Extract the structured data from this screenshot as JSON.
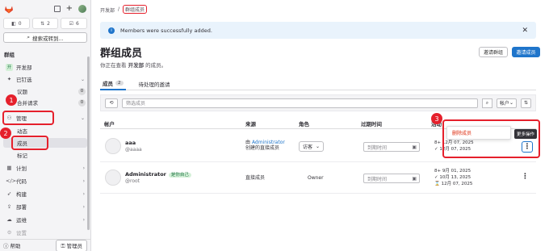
{
  "sidebar": {
    "counters": [
      {
        "icon": "issues-icon",
        "value": "0"
      },
      {
        "icon": "merge-request-icon",
        "value": "2"
      },
      {
        "icon": "todo-icon",
        "value": "6"
      }
    ],
    "search_label": "搜索或转到...",
    "group_label": "群组",
    "items": [
      {
        "label": "开发部",
        "icon": "开"
      },
      {
        "label": "已钉选",
        "icon": "pin-icon"
      },
      {
        "label": "议题",
        "badge": "0"
      },
      {
        "label": "合并请求",
        "badge": "0"
      },
      {
        "label": "管理",
        "icon": "manage-icon"
      },
      {
        "label": "动态"
      },
      {
        "label": "成员"
      },
      {
        "label": "标记"
      },
      {
        "label": "计划"
      },
      {
        "label": "代码"
      },
      {
        "label": "构建"
      },
      {
        "label": "部署"
      },
      {
        "label": "运维"
      },
      {
        "label": "设置"
      }
    ],
    "help_label": "帮助",
    "admin_label": "管理员"
  },
  "breadcrumb": [
    "开发部",
    "群组成员"
  ],
  "alert": {
    "text": "Members were successfully added."
  },
  "page": {
    "title": "群组成员",
    "subtitle_prefix": "你正在查看",
    "subtitle_group": "开发部",
    "subtitle_suffix": "的成员。",
    "invite_group_label": "邀请群组",
    "invite_member_label": "邀请成员"
  },
  "tabs": [
    {
      "label": "成员",
      "count": "2"
    },
    {
      "label": "待处理的邀请"
    }
  ],
  "filter": {
    "placeholder": "筛选成员",
    "sort_label": "帐户"
  },
  "table": {
    "headers": [
      "帐户",
      "来源",
      "角色",
      "过期时间",
      "活动"
    ],
    "rows": [
      {
        "name": "aaa",
        "handle": "@aaaa",
        "source_prefix": "由",
        "source_link": "Administrator",
        "source_suffix": "创建的直接成员",
        "role": "访客",
        "expiry_placeholder": "到期时间",
        "activity": [
          "8",
          "12月 07, 2025",
          "12月 07, 2025"
        ]
      },
      {
        "name": "Administrator",
        "badge": "是你自己",
        "handle": "@root",
        "source": "直接成员",
        "role": "Owner",
        "expiry_placeholder": "到期时间",
        "activity": [
          "9月 01, 2025",
          "10月 13, 2025",
          "12月 07, 2025"
        ]
      }
    ]
  },
  "popover": {
    "label": "删除成员"
  },
  "tooltip": {
    "label": "更多操作"
  },
  "annotations": [
    "1",
    "2",
    "3"
  ],
  "colors": {
    "accent": "#1f75cb",
    "highlight": "#e5202c"
  }
}
